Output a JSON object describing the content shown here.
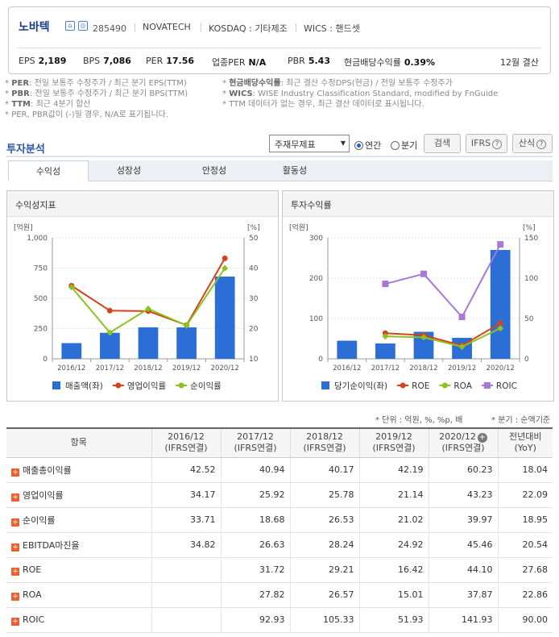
{
  "header": {
    "company": "노바텍",
    "code": "285490",
    "english_name": "NOVATECH",
    "market": "KOSDAQ : 기타제조",
    "wics": "WICS : 핸드셋",
    "stats": [
      {
        "label": "EPS",
        "value": "2,189"
      },
      {
        "label": "BPS",
        "value": "7,086"
      },
      {
        "label": "PER",
        "value": "17.56"
      },
      {
        "label": "업종PER",
        "value": "N/A"
      },
      {
        "label": "PBR",
        "value": "5.43"
      },
      {
        "label": "현금배당수익률",
        "value": "0.39%"
      }
    ],
    "fiscal": "12월 결산"
  },
  "notes": {
    "left": [
      {
        "k": "PER",
        "v": ": 전일 보통주 수정주가 / 최근 분기 EPS(TTM)"
      },
      {
        "k": "PBR",
        "v": ": 전일 보통주 수정주가 / 최근 분기 BPS(TTM)"
      },
      {
        "k": "TTM",
        "v": ": 최근 4분기 합산"
      },
      {
        "k": "",
        "v": "PER, PBR값이 (-)일 경우, N/A로 표기됩니다."
      }
    ],
    "right": [
      {
        "k": "현금배당수익률",
        "v": ": 최근 결산 수정DPS(현금) / 전일 보통주 수정주가"
      },
      {
        "k": "WICS",
        "v": ": WISE Industry Classification Standard, modified by FnGuide"
      },
      {
        "k": "",
        "v": "TTM 데이터가 없는 경우, 최근 결산 데이터로 표시됩니다."
      }
    ]
  },
  "section_title": "투자분석",
  "controls": {
    "select_value": "주재무제표",
    "radio_annual": "연간",
    "radio_quarter": "분기",
    "search": "검색",
    "ifrs": "IFRS",
    "formula": "산식"
  },
  "tabs": [
    "수익성",
    "성장성",
    "안정성",
    "활동성"
  ],
  "panels": {
    "left_title": "수익성지표",
    "right_title": "투자수익률"
  },
  "units_left": "* 단위 : 억원, %, %p, 배",
  "units_right": "* 분기 : 순액기준",
  "table": {
    "head_item": "항목",
    "columns": [
      {
        "p": "2016/12",
        "s": "(IFRS연결)"
      },
      {
        "p": "2017/12",
        "s": "(IFRS연결)"
      },
      {
        "p": "2018/12",
        "s": "(IFRS연결)"
      },
      {
        "p": "2019/12",
        "s": "(IFRS연결)"
      },
      {
        "p": "2020/12",
        "s": "(IFRS연결)"
      },
      {
        "p": "전년대비",
        "s": "(YoY)"
      }
    ],
    "rows": [
      {
        "name": "매출총이익률",
        "vals": [
          "42.52",
          "40.94",
          "40.17",
          "42.19",
          "60.23",
          "18.04"
        ]
      },
      {
        "name": "영업이익률",
        "vals": [
          "34.17",
          "25.92",
          "25.78",
          "21.14",
          "43.23",
          "22.09"
        ]
      },
      {
        "name": "순이익률",
        "vals": [
          "33.71",
          "18.68",
          "26.53",
          "21.02",
          "39.97",
          "18.95"
        ]
      },
      {
        "name": "EBITDA마진율",
        "vals": [
          "34.82",
          "26.63",
          "28.24",
          "24.92",
          "45.46",
          "20.54"
        ]
      },
      {
        "name": "ROE",
        "vals": [
          "",
          "31.72",
          "29.21",
          "16.42",
          "44.10",
          "27.68"
        ]
      },
      {
        "name": "ROA",
        "vals": [
          "",
          "27.82",
          "26.57",
          "15.01",
          "37.87",
          "22.86"
        ]
      },
      {
        "name": "ROIC",
        "vals": [
          "",
          "92.93",
          "105.33",
          "51.93",
          "141.93",
          "90.00"
        ]
      }
    ]
  },
  "chart_data": [
    {
      "type": "bar",
      "categories": [
        "2016/12",
        "2017/12",
        "2018/12",
        "2019/12",
        "2020/12"
      ],
      "left_unit": "[억원]",
      "right_unit": "[%]",
      "ylim_left": [
        0,
        1000
      ],
      "yticks_left": [
        "0",
        "250",
        "500",
        "750",
        "1,000"
      ],
      "ylim_right": [
        10,
        50
      ],
      "yticks_right": [
        "10",
        "20",
        "30",
        "40",
        "50"
      ],
      "series": [
        {
          "name": "매출액(좌)",
          "kind": "bar",
          "axis": "left",
          "color": "#2b6fd6",
          "values": [
            130,
            215,
            260,
            260,
            680
          ]
        },
        {
          "name": "영업이익률",
          "kind": "line",
          "axis": "right",
          "color": "#d4431d",
          "values": [
            34.17,
            25.92,
            25.78,
            21.14,
            43.23
          ]
        },
        {
          "name": "순이익률",
          "kind": "line",
          "axis": "right",
          "color": "#8cc21e",
          "values": [
            33.71,
            18.68,
            26.53,
            21.02,
            39.97
          ]
        }
      ]
    },
    {
      "type": "bar",
      "categories": [
        "2016/12",
        "2017/12",
        "2018/12",
        "2019/12",
        "2020/12"
      ],
      "left_unit": "[억원]",
      "right_unit": "[%]",
      "ylim_left": [
        0,
        300
      ],
      "yticks_left": [
        "0",
        "100",
        "200",
        "300"
      ],
      "ylim_right": [
        0,
        150
      ],
      "yticks_right": [
        "0",
        "50",
        "100",
        "150"
      ],
      "series": [
        {
          "name": "당기순이익(좌)",
          "kind": "bar",
          "axis": "left",
          "color": "#2b6fd6",
          "values": [
            45,
            38,
            67,
            52,
            270
          ]
        },
        {
          "name": "ROE",
          "kind": "line",
          "axis": "right",
          "color": "#d4431d",
          "values": [
            null,
            31.72,
            29.21,
            16.42,
            44.1
          ]
        },
        {
          "name": "ROA",
          "kind": "line",
          "axis": "right",
          "color": "#8cc21e",
          "values": [
            null,
            27.82,
            26.57,
            15.01,
            37.87
          ]
        },
        {
          "name": "ROIC",
          "kind": "line",
          "axis": "right",
          "color": "#a878d8",
          "values": [
            null,
            92.93,
            105.33,
            51.93,
            141.93
          ]
        }
      ]
    }
  ]
}
